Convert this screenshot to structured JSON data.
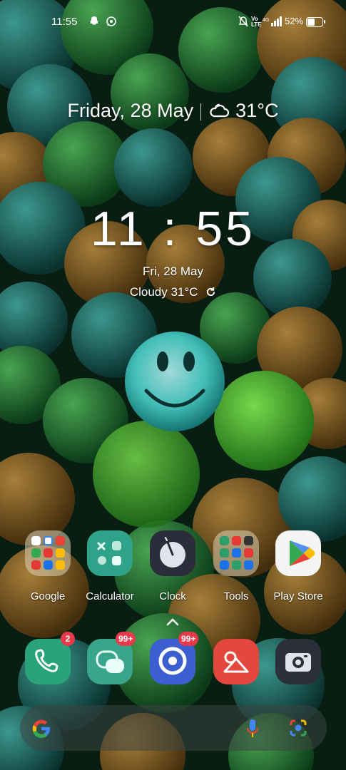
{
  "status_bar": {
    "time": "11:55",
    "battery": "52%",
    "notification_icons": [
      "snapchat-icon",
      "whatsapp-icon"
    ],
    "system_icons": [
      "mute-icon",
      "volte-icon",
      "4g-icon",
      "signal-icon",
      "battery-icon"
    ]
  },
  "date_weather_widget": {
    "date": "Friday, 28 May",
    "temperature": "31°C",
    "icon": "cloudy-icon"
  },
  "clock_widget": {
    "time": "11 : 55",
    "date": "Fri, 28 May",
    "weather": "Cloudy 31°C"
  },
  "apps": [
    {
      "label": "Google"
    },
    {
      "label": "Calculator"
    },
    {
      "label": "Clock"
    },
    {
      "label": "Tools"
    },
    {
      "label": "Play Store"
    }
  ],
  "dock": [
    {
      "name": "phone",
      "badge": "2"
    },
    {
      "name": "messages",
      "badge": "99+"
    },
    {
      "name": "browser",
      "badge": "99+"
    },
    {
      "name": "gallery",
      "badge": ""
    },
    {
      "name": "camera",
      "badge": ""
    }
  ],
  "search_bar": {
    "icons": [
      "google-logo",
      "mic-icon",
      "lens-icon"
    ]
  }
}
